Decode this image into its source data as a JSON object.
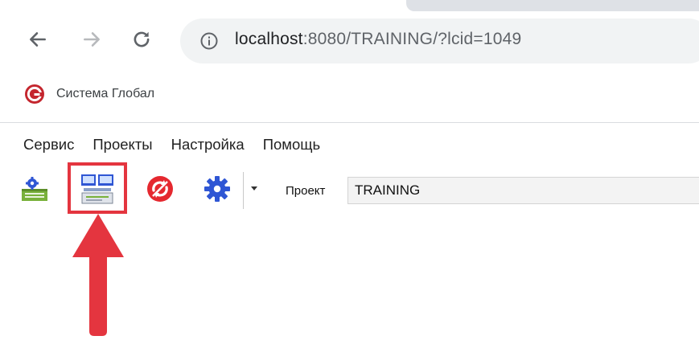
{
  "browser": {
    "url_host": "localhost",
    "url_path": ":8080/TRAINING/?lcid=1049",
    "bookmark_label": "Система Глобал"
  },
  "menu": {
    "items": [
      "Сервис",
      "Проекты",
      "Настройка",
      "Помощь"
    ]
  },
  "toolbar": {
    "buttons": [
      "settings-module-icon",
      "workstation-icon",
      "sync-icon",
      "gear-icon"
    ],
    "highlighted_button": "workstation-icon"
  },
  "project": {
    "label": "Проект",
    "value": "TRAINING"
  },
  "colors": {
    "annotation": "#e4353f",
    "brand": "#c4262e",
    "gear": "#2f56d4",
    "omnibox_bg": "#f1f3f4"
  }
}
